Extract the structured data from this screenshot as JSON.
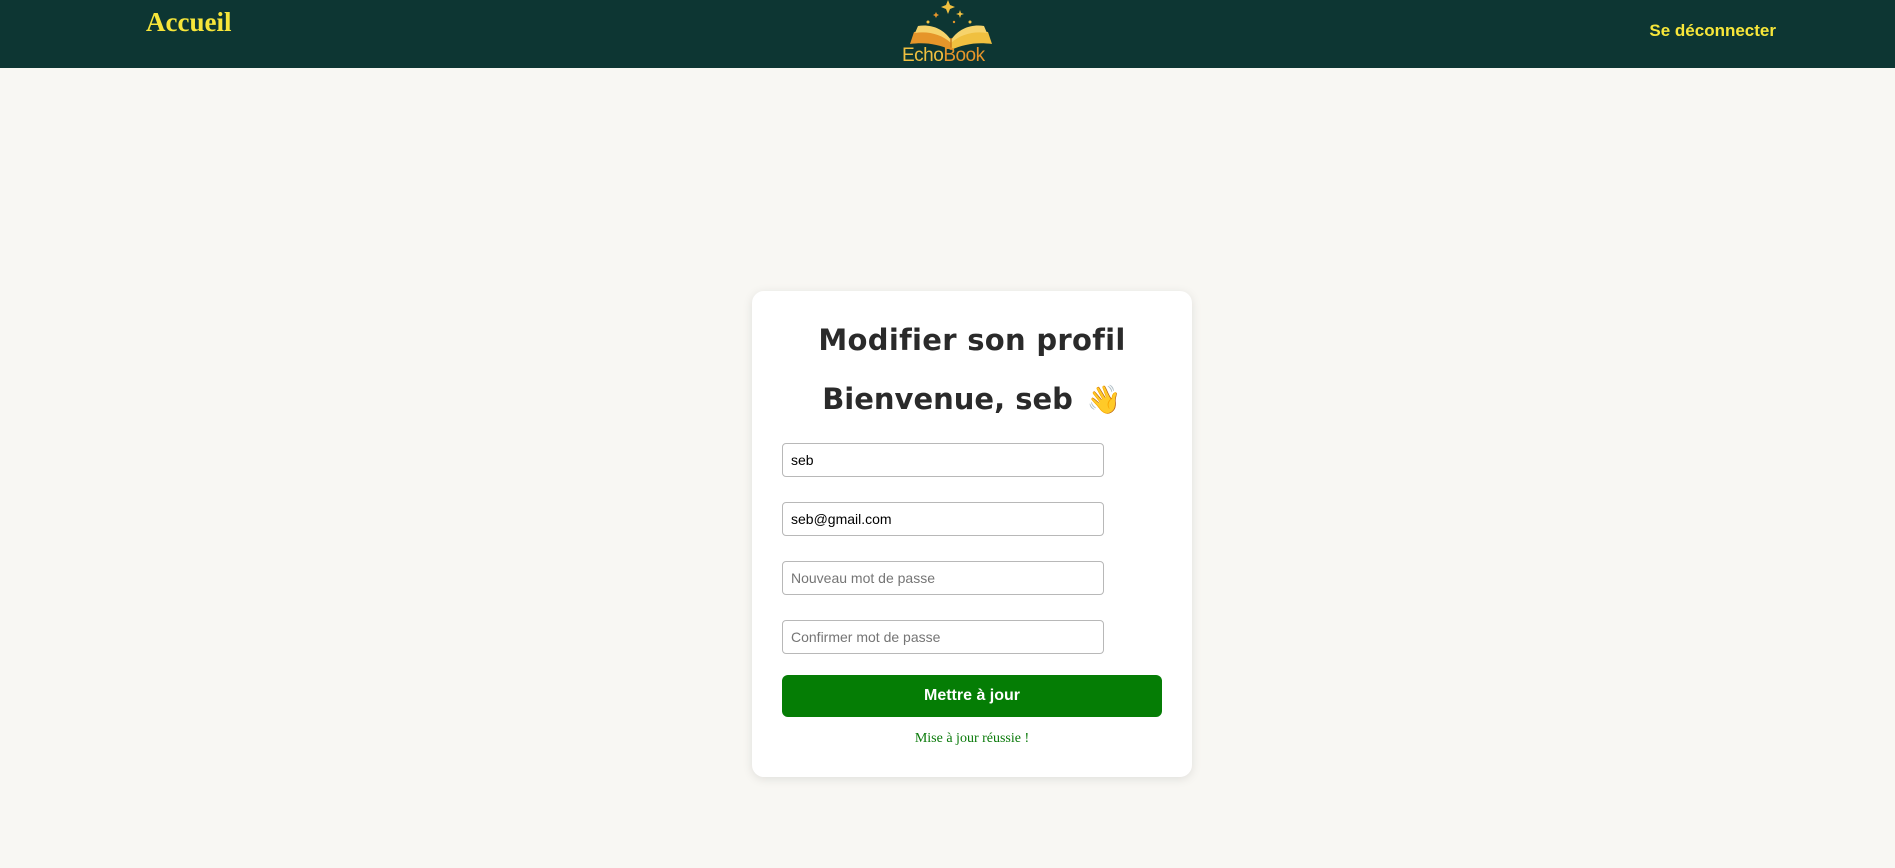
{
  "navbar": {
    "home_label": "Accueil",
    "logout_label": "Se déconnecter",
    "logo": {
      "word1": "Echo",
      "word2": "Book"
    }
  },
  "form": {
    "title": "Modifier son profil",
    "welcome": "Bienvenue, seb",
    "welcome_icon": "👋",
    "username": {
      "value": "seb",
      "placeholder": ""
    },
    "email": {
      "value": "seb@gmail.com",
      "placeholder": ""
    },
    "new_password": {
      "value": "",
      "placeholder": "Nouveau mot de passe"
    },
    "confirm_password": {
      "value": "",
      "placeholder": "Confirmer mot de passe"
    },
    "submit_label": "Mettre à jour",
    "status_message": "Mise à jour réussie !"
  },
  "colors": {
    "navbar_bg": "#0d3633",
    "nav_text": "#f7e63a",
    "button_bg": "#057d05",
    "success_text": "#0a7a0a",
    "page_bg": "#f8f7f3"
  }
}
